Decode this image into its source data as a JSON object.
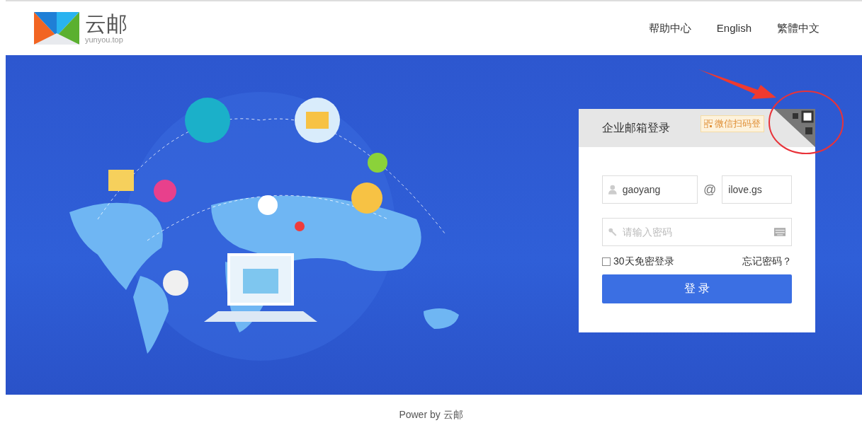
{
  "header": {
    "logo_text": "云邮",
    "logo_subtext": "yunyou.top",
    "nav": [
      "帮助中心",
      "English",
      "繁體中文"
    ]
  },
  "login": {
    "title": "企业邮箱登录",
    "qr_hint": "微信扫码登",
    "username": {
      "value": "gaoyang"
    },
    "at": "@",
    "domain": {
      "value": "ilove.gs"
    },
    "password": {
      "placeholder": "请输入密码"
    },
    "remember": {
      "label": "30天免密登录",
      "checked": false
    },
    "forgot": "忘记密码？",
    "submit": "登 录"
  },
  "footer": "Power by 云邮"
}
